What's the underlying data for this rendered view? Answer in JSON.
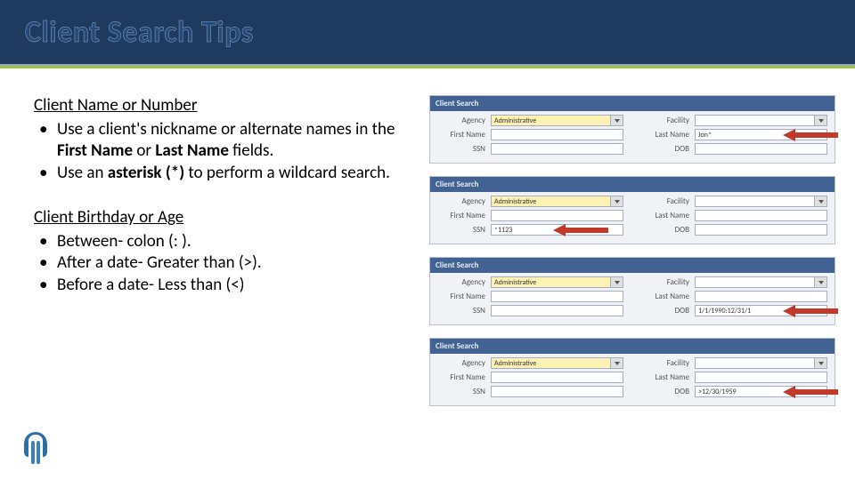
{
  "banner": {
    "title": "Client Search Tips"
  },
  "section1": {
    "heading": "Client Name or Number",
    "b1_pre": "Use a client's nickname or alternate names in the ",
    "b1_bold1": "First Name",
    "b1_mid": " or ",
    "b1_bold2": "Last Name",
    "b1_post": " fields.",
    "b2_pre": "Use an ",
    "b2_bold": "asterisk (*)",
    "b2_post": " to perform a wildcard search."
  },
  "section2": {
    "heading": "Client Birthday or Age",
    "b1": "Between- colon (: ).",
    "b2": "After a date- Greater than (>).",
    "b3": "Before a date- Less than (<)"
  },
  "bullet": "•",
  "panel": {
    "header": "Client Search",
    "labels": {
      "agency": "Agency",
      "facility": "Facility",
      "first": "First Name",
      "last": "Last Name",
      "ssn": "SSN",
      "dob": "DOB"
    },
    "vals": {
      "admin": "Administrative",
      "lastJon": "Jon*",
      "ssn1123": "*1123",
      "dobRange": "1/1/1990:12/31/1",
      "dobAfter": ">12/30/1959"
    }
  }
}
